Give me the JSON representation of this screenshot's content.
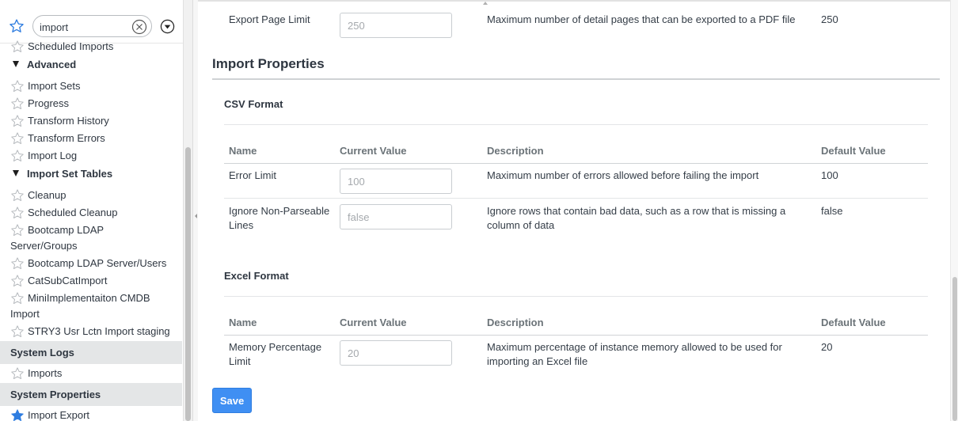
{
  "nav": {
    "filter": {
      "value": "import",
      "placeholder": ""
    },
    "items": [
      {
        "label": "Scheduled Imports"
      },
      {
        "label": "Advanced"
      },
      {
        "label": "Import Sets"
      },
      {
        "label": "Progress"
      },
      {
        "label": "Transform History"
      },
      {
        "label": "Transform Errors"
      },
      {
        "label": "Import Log"
      },
      {
        "label": "Import Set Tables"
      },
      {
        "label": "Cleanup"
      },
      {
        "label": "Scheduled Cleanup"
      },
      {
        "label": "Bootcamp LDAP",
        "label2": "Server/Groups"
      },
      {
        "label": "Bootcamp LDAP Server/Users"
      },
      {
        "label": "CatSubCatImport"
      },
      {
        "label": "MiniImplementaiton CMDB",
        "label2": "Import"
      },
      {
        "label": "STRY3 Usr Lctn Import staging"
      }
    ],
    "sections": [
      {
        "label": "System Logs",
        "items": [
          {
            "label": "Imports"
          }
        ]
      },
      {
        "label": "System Properties",
        "items": [
          {
            "label": "Import Export"
          }
        ]
      }
    ]
  },
  "export_row": {
    "name": "Export Page Limit",
    "value": "250",
    "description": "Maximum number of detail pages that can be exported to a PDF file",
    "default": "250"
  },
  "import_properties": {
    "title": "Import Properties",
    "columns": {
      "name": "Name",
      "current": "Current Value",
      "description": "Description",
      "default": "Default Value"
    },
    "csv": {
      "title": "CSV Format",
      "rows": [
        {
          "name": "Error Limit",
          "value": "100",
          "description": "Maximum number of errors allowed before failing the import",
          "default": "100"
        },
        {
          "name": "Ignore Non-Parseable",
          "name2": "Lines",
          "value": "false",
          "description": "Ignore rows that contain bad data, such as a row that is missing a",
          "description2": "column of data",
          "default": "false"
        }
      ]
    },
    "excel": {
      "title": "Excel Format",
      "rows": [
        {
          "name": "Memory Percentage",
          "name2": "Limit",
          "value": "20",
          "description": "Maximum percentage of instance memory allowed to be used for",
          "description2": "importing an Excel file",
          "default": "20"
        }
      ]
    }
  },
  "save_label": "Save",
  "colors": {
    "accent": "#3f8ff3",
    "favorite": "#2f7de0",
    "section_bg": "#e4e6e7"
  }
}
